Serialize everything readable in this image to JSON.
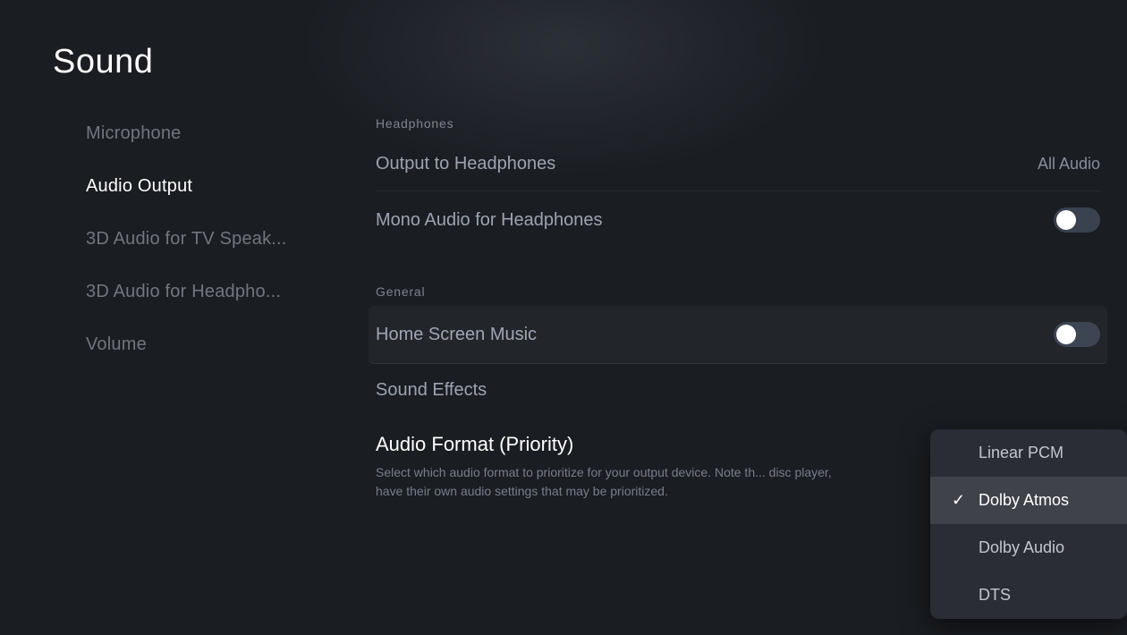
{
  "page": {
    "title": "Sound"
  },
  "sidebar": {
    "items": [
      {
        "id": "microphone",
        "label": "Microphone",
        "active": false
      },
      {
        "id": "audio-output",
        "label": "Audio Output",
        "active": true
      },
      {
        "id": "3d-audio-tv",
        "label": "3D Audio for TV Speak...",
        "active": false
      },
      {
        "id": "3d-audio-headphones",
        "label": "3D Audio for Headpho...",
        "active": false
      },
      {
        "id": "volume",
        "label": "Volume",
        "active": false
      }
    ]
  },
  "content": {
    "headphones_section_label": "Headphones",
    "settings": [
      {
        "id": "output-to-headphones",
        "label": "Output to Headphones",
        "value": "All Audio",
        "type": "value"
      },
      {
        "id": "mono-audio-headphones",
        "label": "Mono Audio for Headphones",
        "value": "",
        "type": "toggle",
        "toggle_state": "off"
      }
    ],
    "general_section_label": "General",
    "general_settings": [
      {
        "id": "home-screen-music",
        "label": "Home Screen Music",
        "type": "toggle",
        "toggle_state": "off"
      },
      {
        "id": "sound-effects",
        "label": "Sound Effects",
        "type": "none"
      }
    ],
    "audio_format": {
      "title": "Audio Format (Priority)",
      "description": "Select which audio format to prioritize for your output device. Note th... disc player, have their own audio settings that may be prioritized."
    }
  },
  "dropdown": {
    "items": [
      {
        "id": "linear-pcm",
        "label": "Linear PCM",
        "selected": false
      },
      {
        "id": "dolby-atmos",
        "label": "Dolby Atmos",
        "selected": true
      },
      {
        "id": "dolby-audio",
        "label": "Dolby Audio",
        "selected": false
      },
      {
        "id": "dts",
        "label": "DTS",
        "selected": false
      }
    ]
  }
}
